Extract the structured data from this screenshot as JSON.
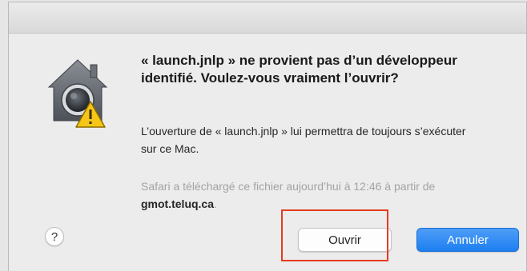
{
  "dialog": {
    "icon": "gatekeeper-warning-icon",
    "heading": "« launch.jnlp » ne provient pas d’un développeur identifié. Voulez-vous vraiment l’ouvrir?",
    "body": "L’ouverture de « launch.jnlp » lui permettra de toujours s’exécuter sur ce Mac.",
    "info_prefix": "Safari a téléchargé ce fichier aujourd’hui à 12:46 à partir de ",
    "info_host": "gmot.teluq.ca",
    "info_suffix": ".",
    "help_label": "?",
    "open_label": "Ouvrir",
    "cancel_label": "Annuler"
  },
  "colors": {
    "accent_button": "#1d7ff0",
    "highlight_outline": "#e63b1f",
    "warning_yellow": "#f5c518"
  }
}
